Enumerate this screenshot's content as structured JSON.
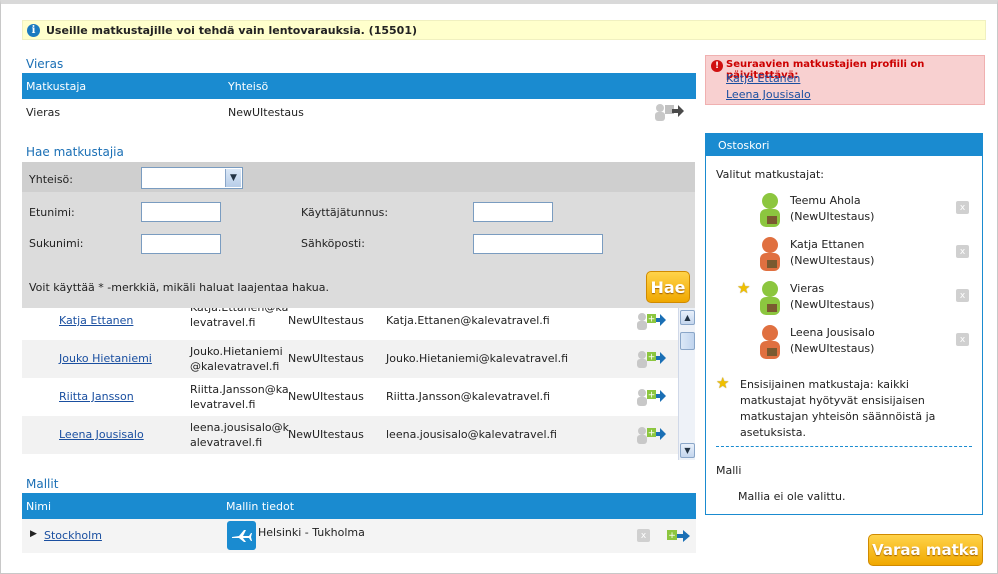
{
  "info_bar": {
    "text": "Useille matkustajille voi tehdä vain lentovarauksia. (15501)"
  },
  "guest_section": {
    "title": "Vieras",
    "columns": [
      "Matkustaja",
      "Yhteisö"
    ],
    "row": {
      "traveler": "Vieras",
      "organization": "NewUItestaus"
    }
  },
  "search_section": {
    "title": "Hae matkustajia",
    "org_label": "Yhteisö:",
    "org_value": "",
    "firstname_label": "Etunimi:",
    "firstname_value": "",
    "username_label": "Käyttäjätunnus:",
    "username_value": "",
    "lastname_label": "Sukunimi:",
    "lastname_value": "",
    "email_label": "Sähköposti:",
    "email_value": "",
    "hint": "Voit käyttää * -merkkiä, mikäli haluat laajentaa hakua.",
    "search_button": "Hae"
  },
  "results": [
    {
      "name": "Katja Ettanen",
      "username": "Katja.Ettanen@kalevatravel.fi",
      "organization": "NewUItestaus",
      "email": "Katja.Ettanen@kalevatravel.fi"
    },
    {
      "name": "Jouko Hietaniemi",
      "username": "Jouko.Hietaniemi@kalevatravel.fi",
      "organization": "NewUItestaus",
      "email": "Jouko.Hietaniemi@kalevatravel.fi"
    },
    {
      "name": "Riitta Jansson",
      "username": "Riitta.Jansson@kalevatravel.fi",
      "organization": "NewUItestaus",
      "email": "Riitta.Jansson@kalevatravel.fi"
    },
    {
      "name": "Leena Jousisalo",
      "username": "leena.jousisalo@kalevatravel.fi",
      "organization": "NewUItestaus",
      "email": "leena.jousisalo@kalevatravel.fi"
    }
  ],
  "templates_section": {
    "title": "Mallit",
    "columns": [
      "Nimi",
      "Mallin tiedot"
    ],
    "row": {
      "name": "Stockholm",
      "details": "Helsinki - Tukholma"
    }
  },
  "warning": {
    "title": "Seuraavien matkustajien profiili on päivitettävä:",
    "links": [
      "Katja Ettanen",
      "Leena Jousisalo"
    ]
  },
  "cart": {
    "title": "Ostoskori",
    "selected_label": "Valitut matkustajat:",
    "travelers": [
      {
        "name": "Teemu Ahola",
        "org": "(NewUItestaus)",
        "avatar_color": "#8cc63f",
        "primary": false
      },
      {
        "name": "Katja Ettanen",
        "org": "(NewUItestaus)",
        "avatar_color": "#e07040",
        "primary": false
      },
      {
        "name": "Vieras",
        "org": "(NewUItestaus)",
        "avatar_color": "#8cc63f",
        "primary": true
      },
      {
        "name": "Leena Jousisalo",
        "org": "(NewUItestaus)",
        "avatar_color": "#e07040",
        "primary": false
      }
    ],
    "remove_glyph": "x",
    "primary_note": "Ensisijainen matkustaja: kaikki matkustajat hyötyvät ensisijaisen matkustajan yhteisön säännöistä ja asetuksista.",
    "template_label": "Malli",
    "template_value": "Mallia ei ole valittu."
  },
  "book_button": "Varaa matka",
  "colors": {
    "accent_blue": "#1a8bd0",
    "link": "#1a4fa0",
    "button_orange": "#f0a800",
    "warning_bg": "#f8d0d0"
  }
}
